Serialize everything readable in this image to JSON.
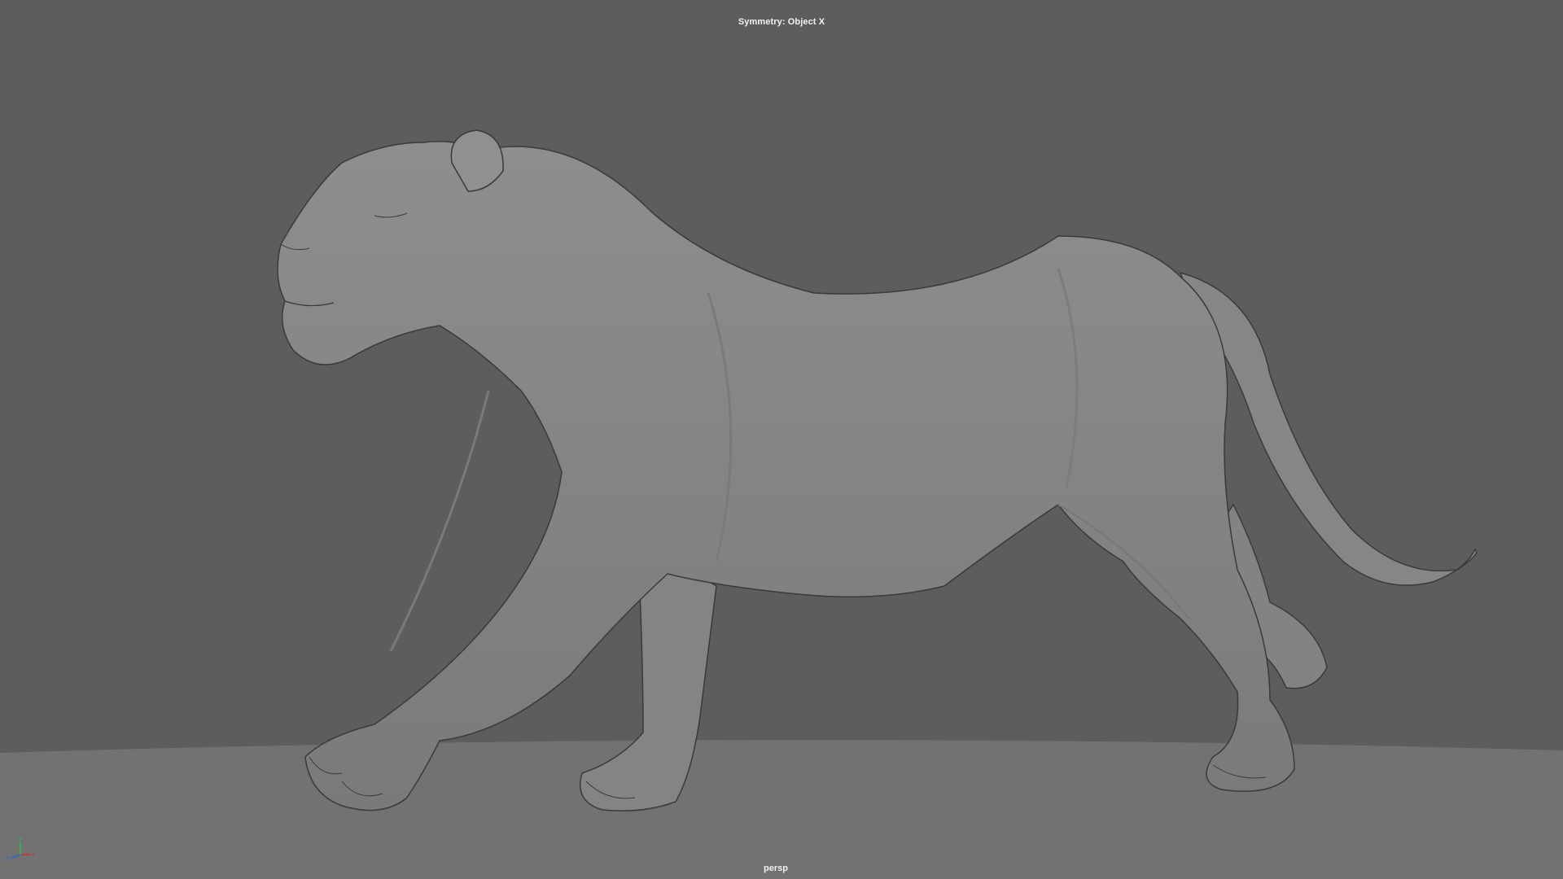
{
  "viewport": {
    "hud_symmetry": "Symmetry: Object X",
    "camera_label": "persp",
    "model_icon": "lioness-sculpt-mesh",
    "gizmo_icon": "xyz-axis-gizmo",
    "axes": {
      "x": "X",
      "y": "Y",
      "z": "Z"
    }
  },
  "colors": {
    "background": "#5d5d5d",
    "ground": "#727272",
    "mesh": "#8a8a8a",
    "hud_text": "#f2f2f2",
    "axis_x": "#d03030",
    "axis_y": "#30c040",
    "axis_z": "#3060e0"
  }
}
